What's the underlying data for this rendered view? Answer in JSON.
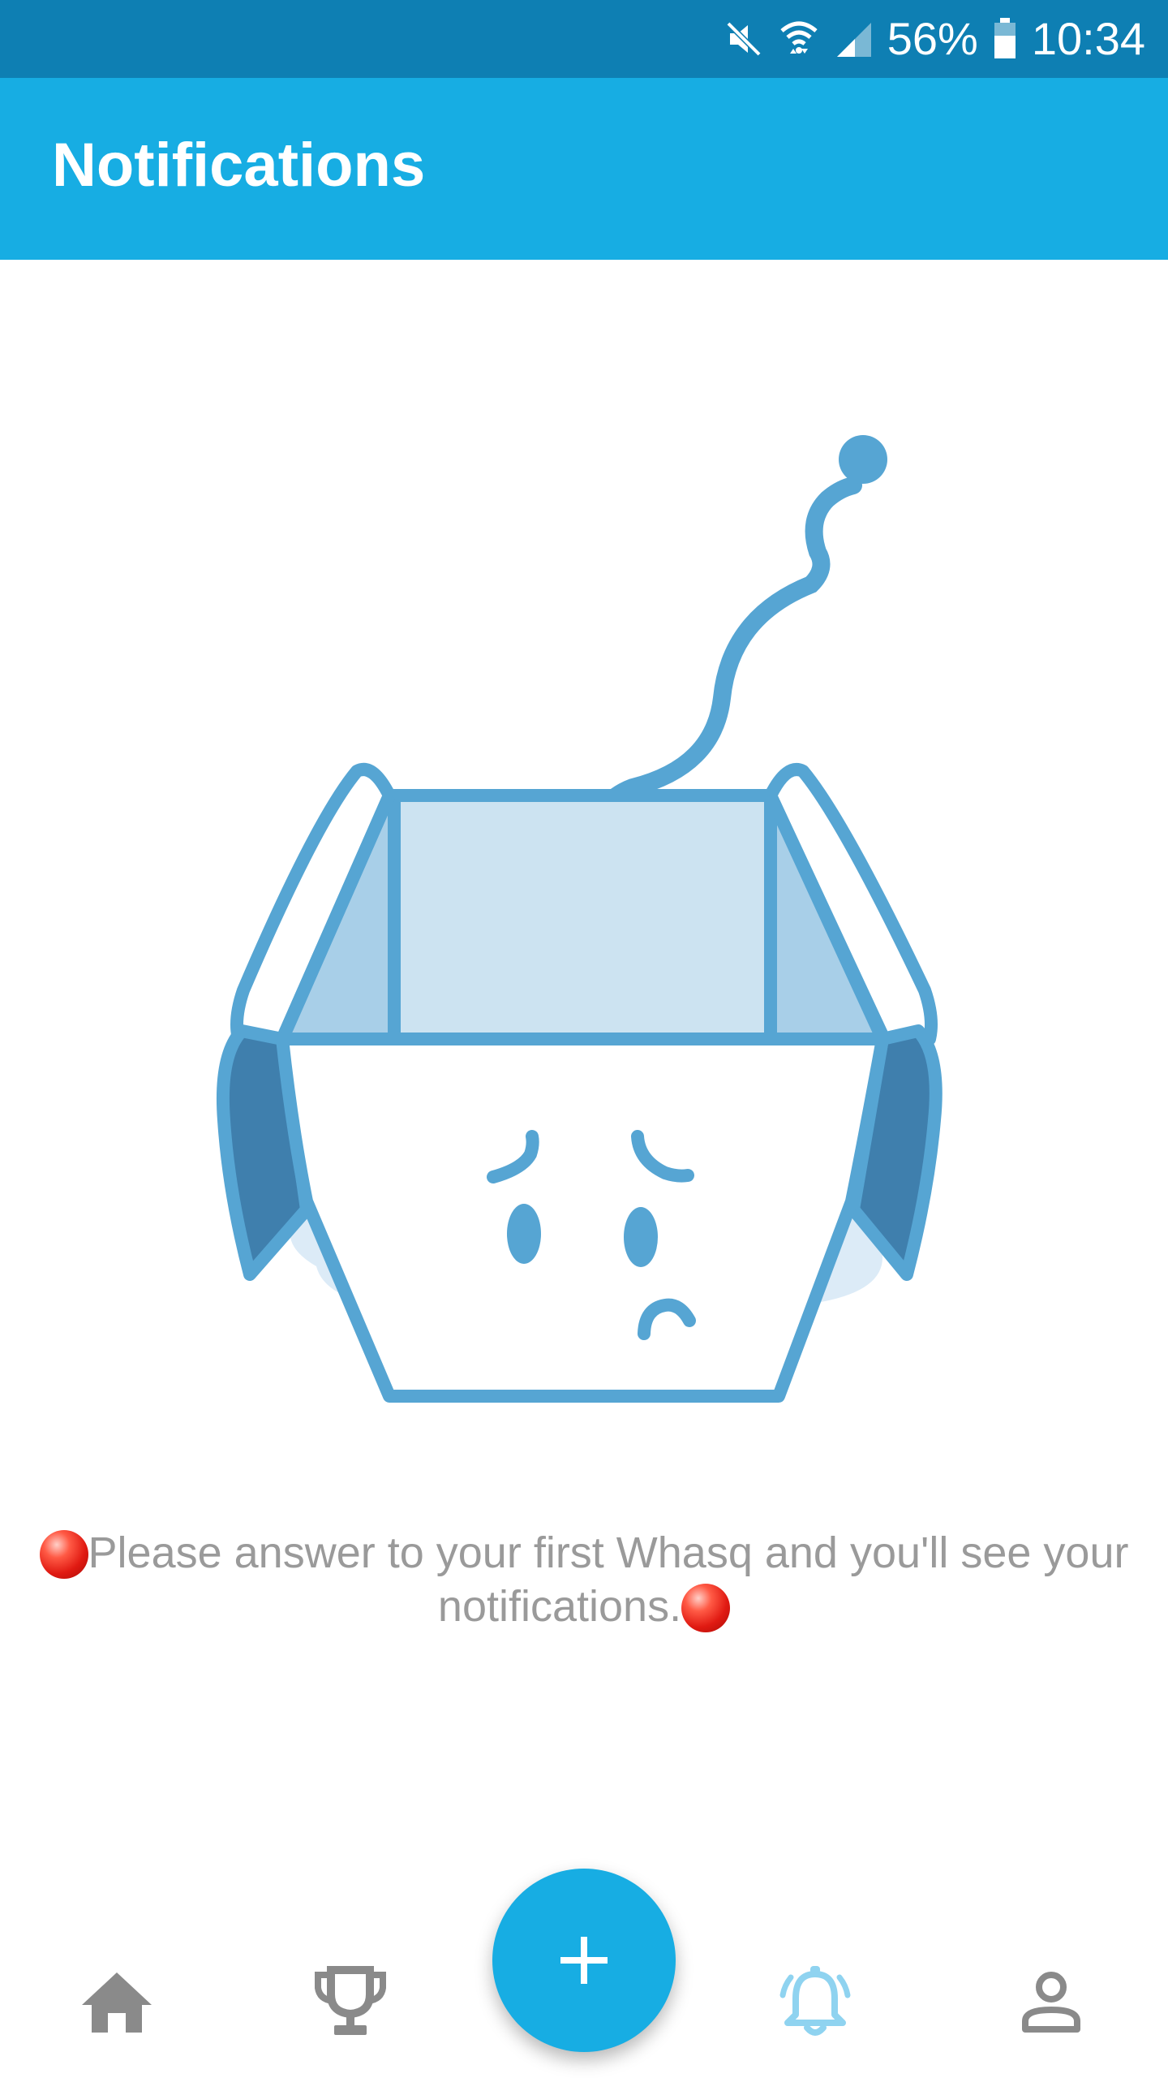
{
  "status_bar": {
    "battery": "56%",
    "time": "10:34",
    "icons": [
      "mute-icon",
      "wifi-icon",
      "signal-icon",
      "battery-icon"
    ]
  },
  "app_bar": {
    "title": "Notifications"
  },
  "empty_state": {
    "illustration": "sad-empty-box-illustration",
    "message_line1": "Please answer to your first Whasq and you'll see your",
    "message_line2": "notifications."
  },
  "bottom_nav": {
    "items": [
      {
        "icon": "home-icon",
        "active": false
      },
      {
        "icon": "trophy-icon",
        "active": false
      },
      {
        "icon": "bell-icon",
        "active": true
      },
      {
        "icon": "profile-icon",
        "active": false
      }
    ],
    "fab_icon": "plus-icon"
  },
  "colors": {
    "status_bar": "#0e7fb3",
    "app_bar": "#17ade3",
    "illustration": "#56a5d3",
    "inactive_icon": "#8a8a8a",
    "active_icon": "#8fd3f0",
    "message_text": "#9a9a9a"
  }
}
